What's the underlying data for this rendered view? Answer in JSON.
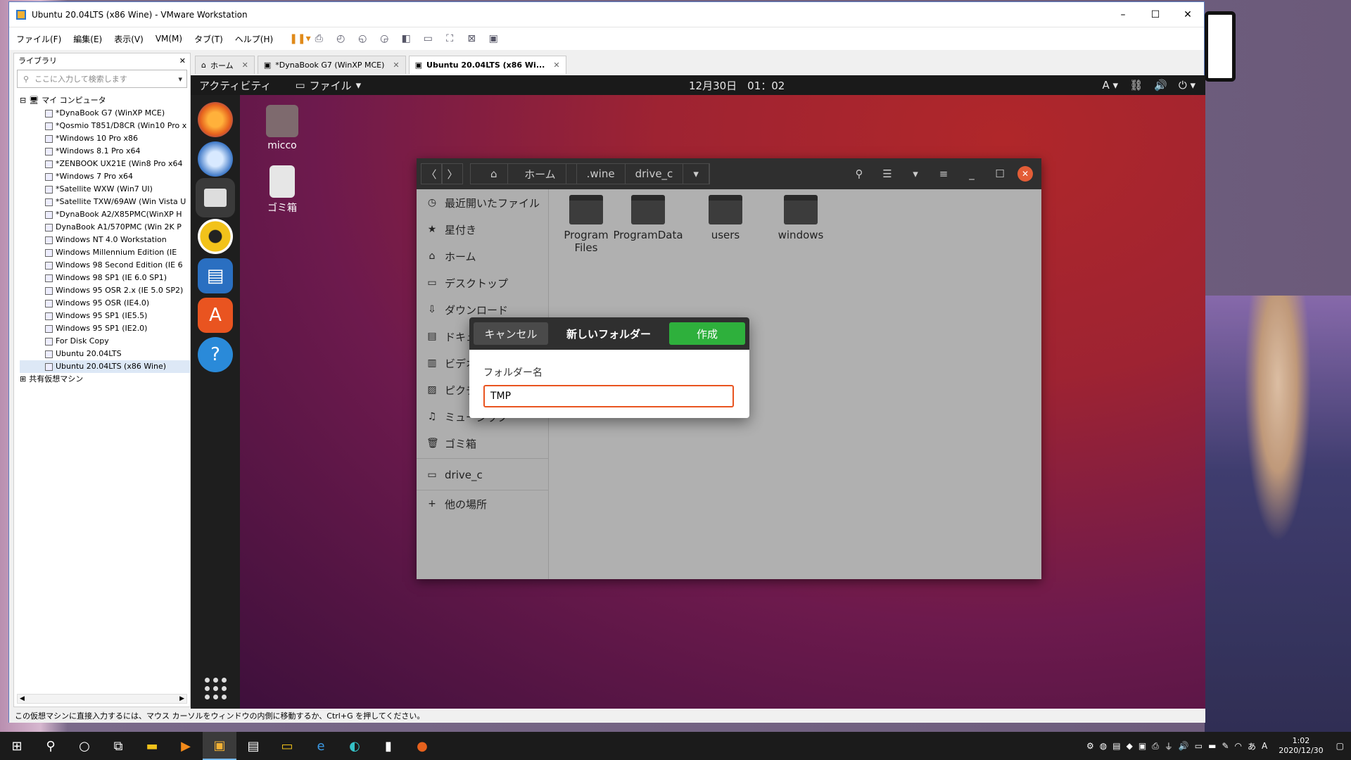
{
  "vmware": {
    "title": "Ubuntu 20.04LTS (x86 Wine) - VMware Workstation",
    "window_controls": [
      "–",
      "☐",
      "✕"
    ],
    "menu": [
      "ファイル(F)",
      "編集(E)",
      "表示(V)",
      "VM(M)",
      "タブ(T)",
      "ヘルプ(H)"
    ],
    "library": {
      "title": "ライブラリ",
      "search_placeholder": "ここに入力して検索します",
      "root": "マイ コンピュータ",
      "vms": [
        "*DynaBook G7 (WinXP MCE)",
        "*Qosmio T851/D8CR (Win10 Pro x",
        "*Windows 10 Pro x86",
        "*Windows 8.1 Pro x64",
        "*ZENBOOK UX21E (Win8 Pro x64",
        "*Windows 7 Pro x64",
        "*Satellite WXW (Win7 UI)",
        "*Satellite TXW/69AW (Win Vista U",
        "*DynaBook A2/X85PMC(WinXP H",
        "DynaBook A1/570PMC (Win 2K P",
        "Windows NT 4.0 Workstation",
        "Windows Millennium Edition (IE",
        "Windows 98 Second Edition (IE 6",
        "Windows 98 SP1 (IE 6.0 SP1)",
        "Windows 95 OSR 2.x (IE 5.0 SP2)",
        "Windows 95 OSR (IE4.0)",
        "Windows 95 SP1 (IE5.5)",
        "Windows 95 SP1 (IE2.0)",
        "For Disk Copy",
        "Ubuntu 20.04LTS",
        "Ubuntu 20.04LTS (x86 Wine)"
      ],
      "shared": "共有仮想マシン"
    },
    "tabs": [
      {
        "label": "ホーム",
        "active": false
      },
      {
        "label": "*DynaBook G7 (WinXP MCE)",
        "active": false
      },
      {
        "label": "Ubuntu 20.04LTS (x86 Wi...",
        "active": true
      }
    ],
    "status": "この仮想マシンに直接入力するには、マウス カーソルをウィンドウの内側に移動するか、Ctrl+G を押してください。"
  },
  "ubuntu": {
    "activities": "アクティビティ",
    "app_menu": "ファイル",
    "clock": "12月30日　01：02",
    "input_method": "A",
    "desktop": [
      {
        "label": "micco"
      },
      {
        "label": "ゴミ箱"
      }
    ],
    "nautilus": {
      "breadcrumb": [
        "ホーム",
        ".wine",
        "drive_c"
      ],
      "sidebar": [
        {
          "icon": "clock-icon",
          "glyph": "◷",
          "label": "最近開いたファイル"
        },
        {
          "icon": "star-icon",
          "glyph": "★",
          "label": "星付き"
        },
        {
          "icon": "home-icon",
          "glyph": "⌂",
          "label": "ホーム"
        },
        {
          "icon": "desktop-icon",
          "glyph": "▭",
          "label": "デスクトップ"
        },
        {
          "icon": "download-icon",
          "glyph": "⇩",
          "label": "ダウンロード"
        },
        {
          "icon": "document-icon",
          "glyph": "▤",
          "label": "ドキュメント"
        },
        {
          "icon": "video-icon",
          "glyph": "▥",
          "label": "ビデオ"
        },
        {
          "icon": "picture-icon",
          "glyph": "▨",
          "label": "ピクチャ"
        },
        {
          "icon": "music-icon",
          "glyph": "♫",
          "label": "ミュージック"
        },
        {
          "icon": "trash-icon",
          "glyph": "🗑",
          "label": "ゴミ箱"
        }
      ],
      "drive": "drive_c",
      "other_places": "他の場所",
      "folders": [
        "Program Files",
        "ProgramData",
        "users",
        "windows"
      ]
    },
    "dialog": {
      "cancel": "キャンセル",
      "title": "新しいフォルダー",
      "create": "作成",
      "field_label": "フォルダー名",
      "field_value": "TMP"
    }
  },
  "taskbar": {
    "clock_time": "1:02",
    "clock_date": "2020/12/30",
    "ime": "あ"
  }
}
